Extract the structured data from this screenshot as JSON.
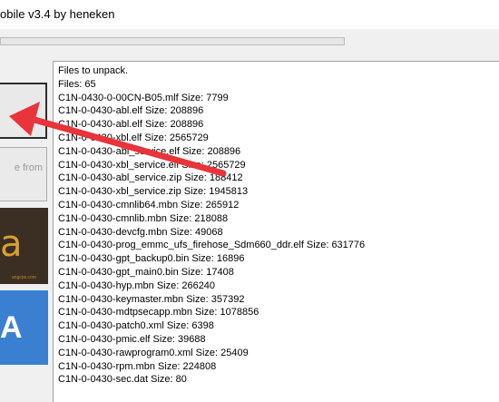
{
  "window": {
    "title": "obile v3.4 by heneken"
  },
  "progress": {
    "value": 0
  },
  "buttons": {
    "unpack_label": "",
    "restore_label": "e from"
  },
  "banners": {
    "a_glyph": "a",
    "a_footer": "angcps.com",
    "b_glyph": "A"
  },
  "log": {
    "lines": [
      "Files to unpack.",
      "Files: 65",
      "C1N-0430-0-00CN-B05.mlf Size: 7799",
      "C1N-0-0430-abl.elf Size: 208896",
      "C1N-0-0430-abl.elf Size: 208896",
      "C1N-0-0430-xbl.elf Size: 2565729",
      "C1N-0-0430-abl_service.elf Size: 208896",
      "C1N-0-0430-xbl_service.elf Size: 2565729",
      "C1N-0-0430-abl_service.zip Size: 188412",
      "C1N-0-0430-xbl_service.zip Size: 1945813",
      "C1N-0-0430-cmnlib64.mbn Size: 265912",
      "C1N-0-0430-cmnlib.mbn Size: 218088",
      "C1N-0-0430-devcfg.mbn Size: 49068",
      "C1N-0-0430-prog_emmc_ufs_firehose_Sdm660_ddr.elf Size: 631776",
      "C1N-0-0430-gpt_backup0.bin Size: 16896",
      "C1N-0-0430-gpt_main0.bin Size: 17408",
      "C1N-0-0430-hyp.mbn Size: 266240",
      "C1N-0-0430-keymaster.mbn Size: 357392",
      "C1N-0-0430-mdtpsecapp.mbn Size: 1078856",
      "C1N-0-0430-patch0.xml Size: 6398",
      "C1N-0-0430-pmic.elf Size: 39688",
      "C1N-0-0430-rawprogram0.xml Size: 25409",
      "C1N-0-0430-rpm.mbn Size: 224808",
      "C1N-0-0430-sec.dat Size: 80"
    ]
  },
  "annotation": {
    "arrow_color": "#e8343a",
    "icon": "red-arrow-icon"
  }
}
